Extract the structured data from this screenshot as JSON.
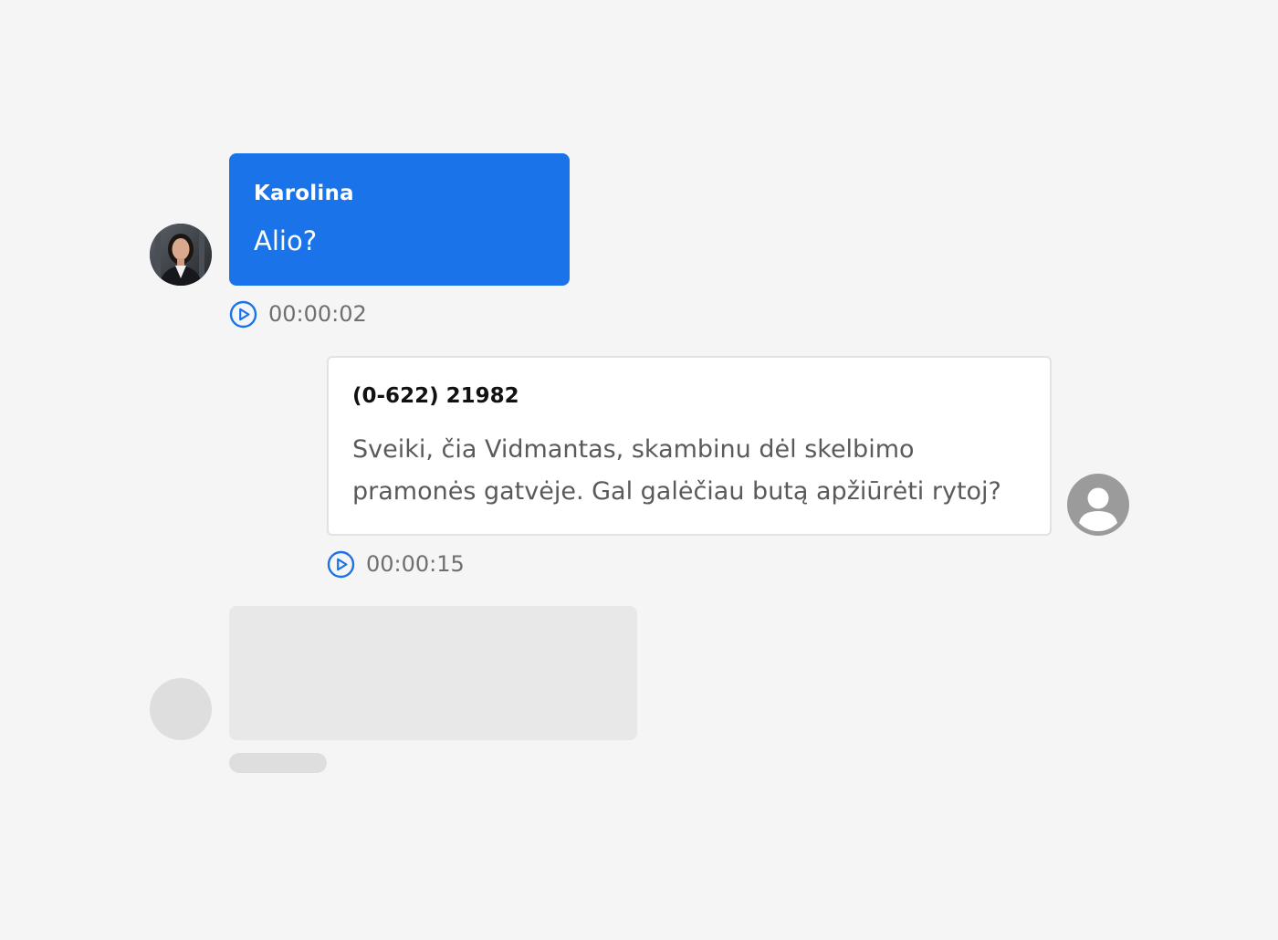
{
  "messages": [
    {
      "sender": "Karolina",
      "text": "Alio?",
      "duration": "00:00:02",
      "avatar_icon": "person-photo-icon",
      "bubble_color": "#1a73e8",
      "play_icon": "play-circle-icon"
    },
    {
      "sender": "(0-622) 21982",
      "text_line1": "Sveiki, čia Vidmantas, skambinu dėl skelbimo",
      "text_line2": "pramonės gatvėje. Gal galėčiau butą apžiūrėti rytoj?",
      "duration": "00:00:15",
      "avatar_icon": "user-placeholder-icon",
      "bubble_color": "#ffffff",
      "play_icon": "play-circle-icon"
    }
  ],
  "colors": {
    "background": "#f5f5f5",
    "accent": "#1a73e8",
    "skeleton": "#e8e8e8"
  }
}
